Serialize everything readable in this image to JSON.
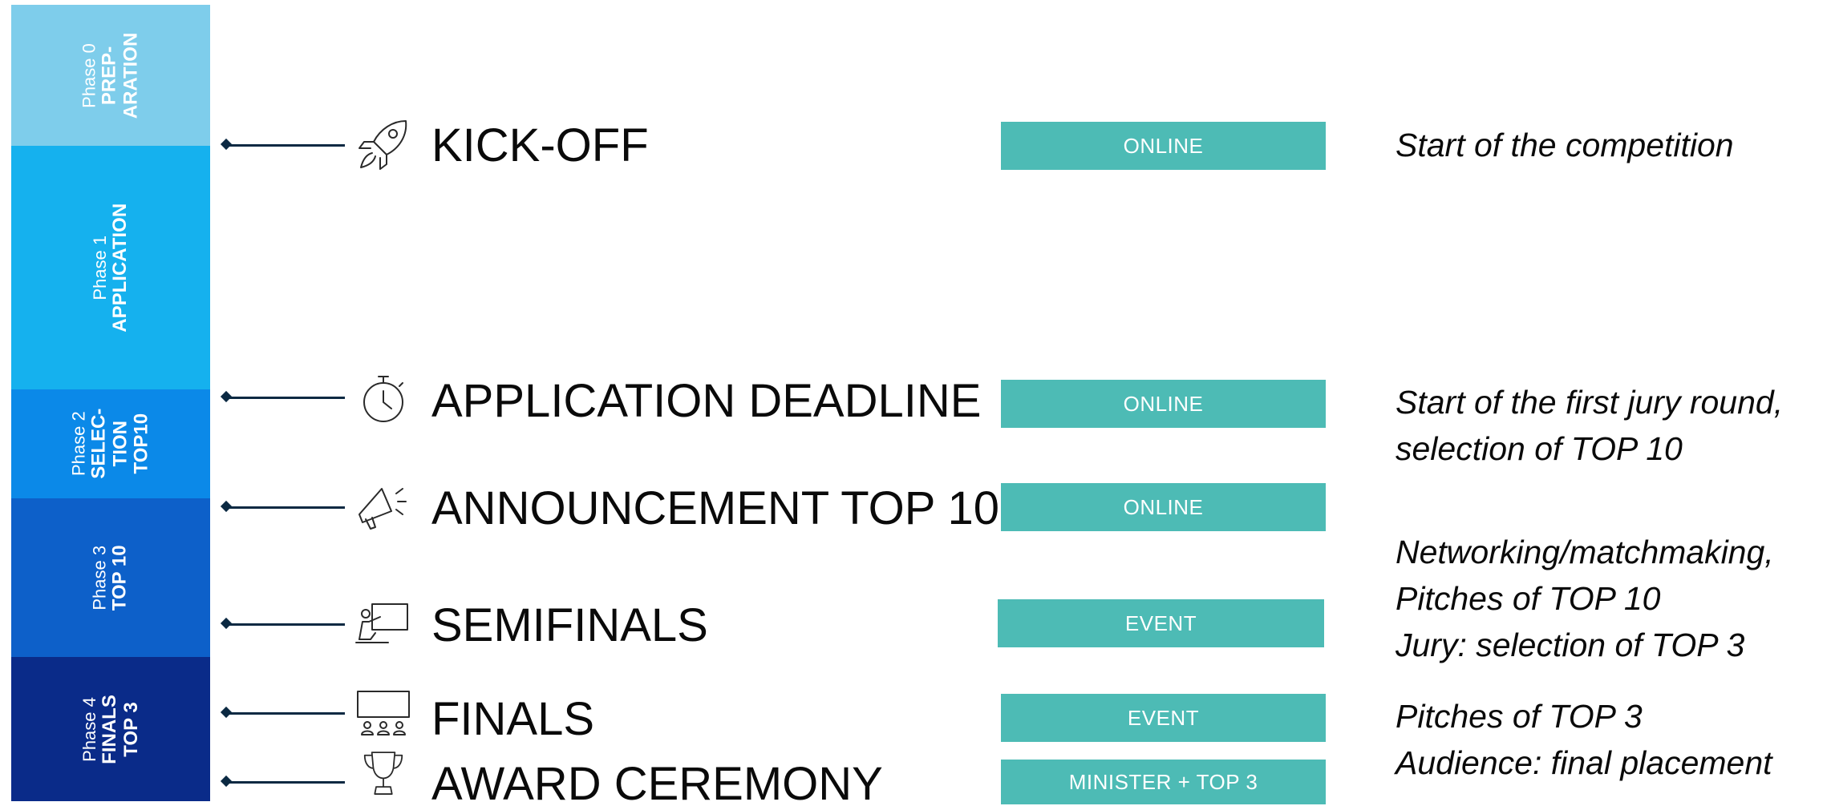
{
  "phases": [
    {
      "num": "Phase 0",
      "name": "PREP-\nARATION",
      "color": "#7ecdeb"
    },
    {
      "num": "Phase 1",
      "name": "APPLICATION",
      "color": "#15b1ee"
    },
    {
      "num": "Phase 2",
      "name": "SELEC-\nTION\nTOP10",
      "color": "#0b89e8"
    },
    {
      "num": "Phase 3",
      "name": "TOP 10",
      "color": "#0d60c9"
    },
    {
      "num": "Phase 4",
      "name": "FINALS\nTOP 3",
      "color": "#0a2b89"
    }
  ],
  "milestones": [
    {
      "label": "KICK-OFF",
      "icon": "rocket-icon",
      "badge": "ONLINE"
    },
    {
      "label": "APPLICATION DEADLINE",
      "icon": "stopwatch-icon",
      "badge": "ONLINE"
    },
    {
      "label": "ANNOUNCEMENT TOP 10",
      "icon": "megaphone-icon",
      "badge": "ONLINE"
    },
    {
      "label": "SEMIFINALS",
      "icon": "presentation-icon",
      "badge": "EVENT"
    },
    {
      "label": "FINALS",
      "icon": "stage-audience-icon",
      "badge": "EVENT"
    },
    {
      "label": "AWARD CEREMONY",
      "icon": "trophy-icon",
      "badge": "MINISTER + TOP 3"
    }
  ],
  "descriptions": {
    "kickoff": "Start of the competition",
    "deadline_1": "Start of the first jury round,",
    "deadline_2": "selection of TOP 10",
    "top10_1": "Networking/matchmaking,",
    "top10_2": "Pitches of TOP 10",
    "top10_3": "Jury: selection of TOP 3",
    "finals_1": "Pitches of TOP 3",
    "finals_2": "Audience: final placement"
  },
  "colors": {
    "badge": "#4dbbb5",
    "connector": "#0b2942"
  }
}
